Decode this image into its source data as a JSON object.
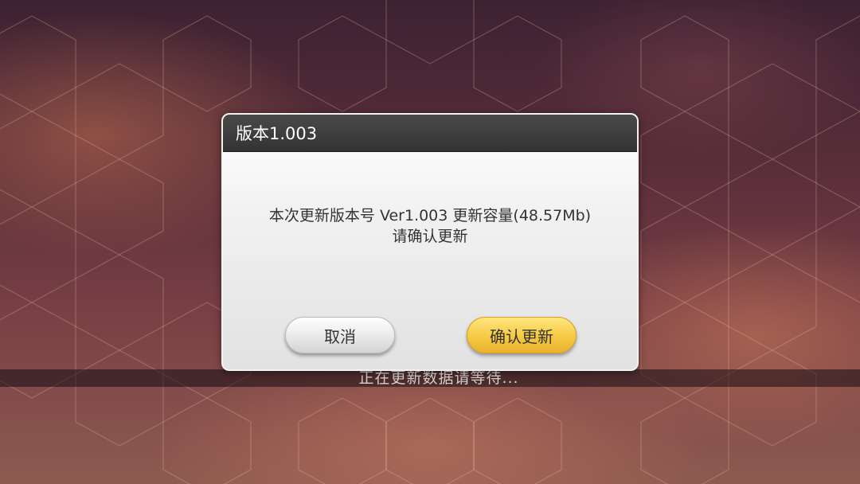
{
  "background": {
    "status_text": "正在更新数据请等待..."
  },
  "dialog": {
    "title": "版本1.003",
    "message_line1": "本次更新版本号 Ver1.003 更新容量(48.57Mb)",
    "message_line2": "请确认更新",
    "cancel_label": "取消",
    "confirm_label": "确认更新"
  },
  "colors": {
    "header_bg": "#3a3a3a",
    "confirm_button": "#f6c942",
    "cancel_button": "#e9e9e9",
    "status_text": "#d8cfcf"
  }
}
